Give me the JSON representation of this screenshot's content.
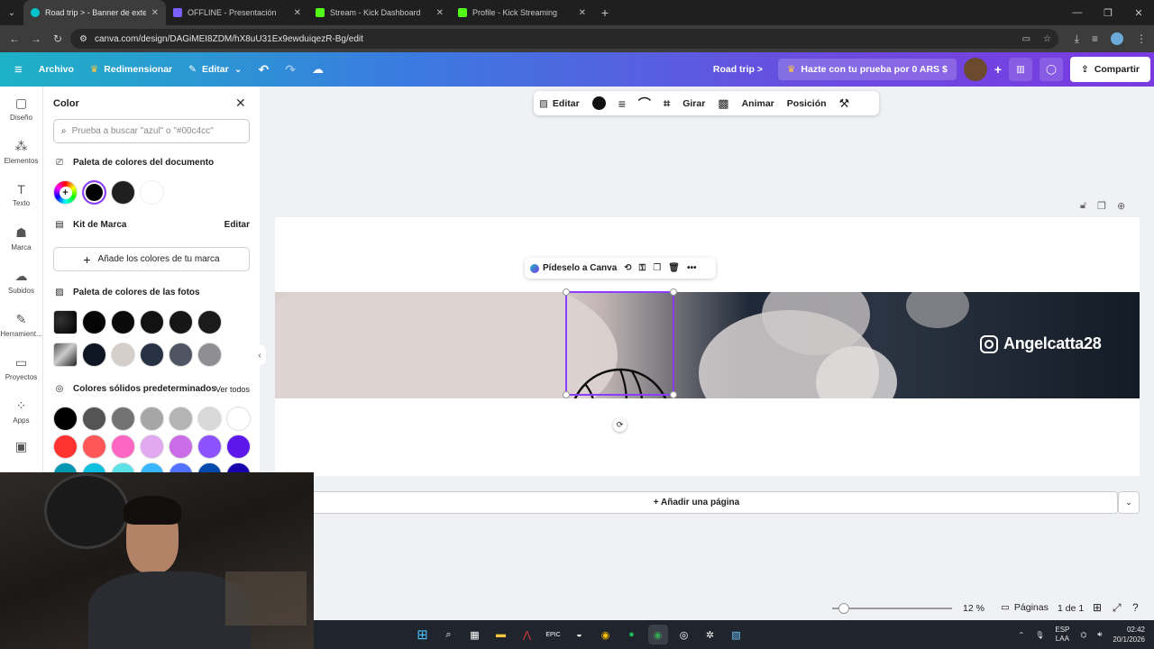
{
  "browser": {
    "tabs": [
      {
        "title": "Road trip > - Banner de exterio",
        "active": true,
        "color": "#00c4cc"
      },
      {
        "title": "OFFLINE - Presentación",
        "active": false,
        "color": "#7b61ff"
      },
      {
        "title": "Stream - Kick Dashboard",
        "active": false,
        "color": "#53fc18"
      },
      {
        "title": "Profile - Kick Streaming",
        "active": false,
        "color": "#53fc18"
      }
    ],
    "url": "canva.com/design/DAGiMEI8ZDM/hX8uU31Ex9ewduiqezR-Bg/edit"
  },
  "topbar": {
    "file": "Archivo",
    "resize": "Redimensionar",
    "edit": "Editar",
    "design_title": "Road trip >",
    "trial": "Hazte con tu prueba por 0 ARS $",
    "share": "Compartir"
  },
  "rail": {
    "items": [
      {
        "label": "Diseño",
        "icon": "▢"
      },
      {
        "label": "Elementos",
        "icon": "⁂"
      },
      {
        "label": "Texto",
        "icon": "T"
      },
      {
        "label": "Marca",
        "icon": "☗"
      },
      {
        "label": "Subidos",
        "icon": "☁"
      },
      {
        "label": "Herramient...",
        "icon": "✎"
      },
      {
        "label": "Proyectos",
        "icon": "▭"
      },
      {
        "label": "Apps",
        "icon": "⁘"
      }
    ]
  },
  "panel": {
    "title": "Color",
    "search_placeholder": "Prueba a buscar \"azul\" o \"#00c4cc\"",
    "doc_palette": "Paleta de colores del documento",
    "doc_colors": [
      "#000000",
      "#1f1f1f",
      "#ffffff"
    ],
    "brand_kit": "Kit de Marca",
    "brand_edit": "Editar",
    "brand_add": "Añade los colores de tu marca",
    "photo_palette": "Paleta de colores de las fotos",
    "photo_row1": [
      "#050505",
      "#0a0a0a",
      "#121212",
      "#161616",
      "#1b1b1b"
    ],
    "photo_row2": [
      "#0f1623",
      "#d4cdca",
      "#263244",
      "#4f5562",
      "#8f8f93"
    ],
    "solid_title": "Colores sólidos predeterminados",
    "see_all": "Ver todos",
    "solid_row1": [
      "#000000",
      "#545454",
      "#737373",
      "#a6a6a6",
      "#b4b4b4",
      "#d9d9d9",
      "#ffffff"
    ],
    "solid_row2": [
      "#ff3131",
      "#ff5757",
      "#ff66c4",
      "#e2a9f1",
      "#cb6ce6",
      "#8c52ff",
      "#5e17eb"
    ],
    "solid_row3": [
      "#0097b2",
      "#0cc0df",
      "#5ce1e6",
      "#38b6ff",
      "#5271ff",
      "#004aad",
      "#1800ad"
    ]
  },
  "toolbar": {
    "edit": "Editar",
    "rotate": "Girar",
    "animate": "Animar",
    "position": "Posición"
  },
  "context": {
    "ask": "Pídeselo a Canva"
  },
  "banner": {
    "handle": "Angelcatta28"
  },
  "footer": {
    "add_page": "+ Añadir una página",
    "zoom": "12 %",
    "pages_label": "Páginas",
    "page_count": "1 de 1"
  },
  "taskbar": {
    "lang1": "ESP",
    "lang2": "LAA",
    "time": "02:42",
    "date": "20/1/2026"
  }
}
